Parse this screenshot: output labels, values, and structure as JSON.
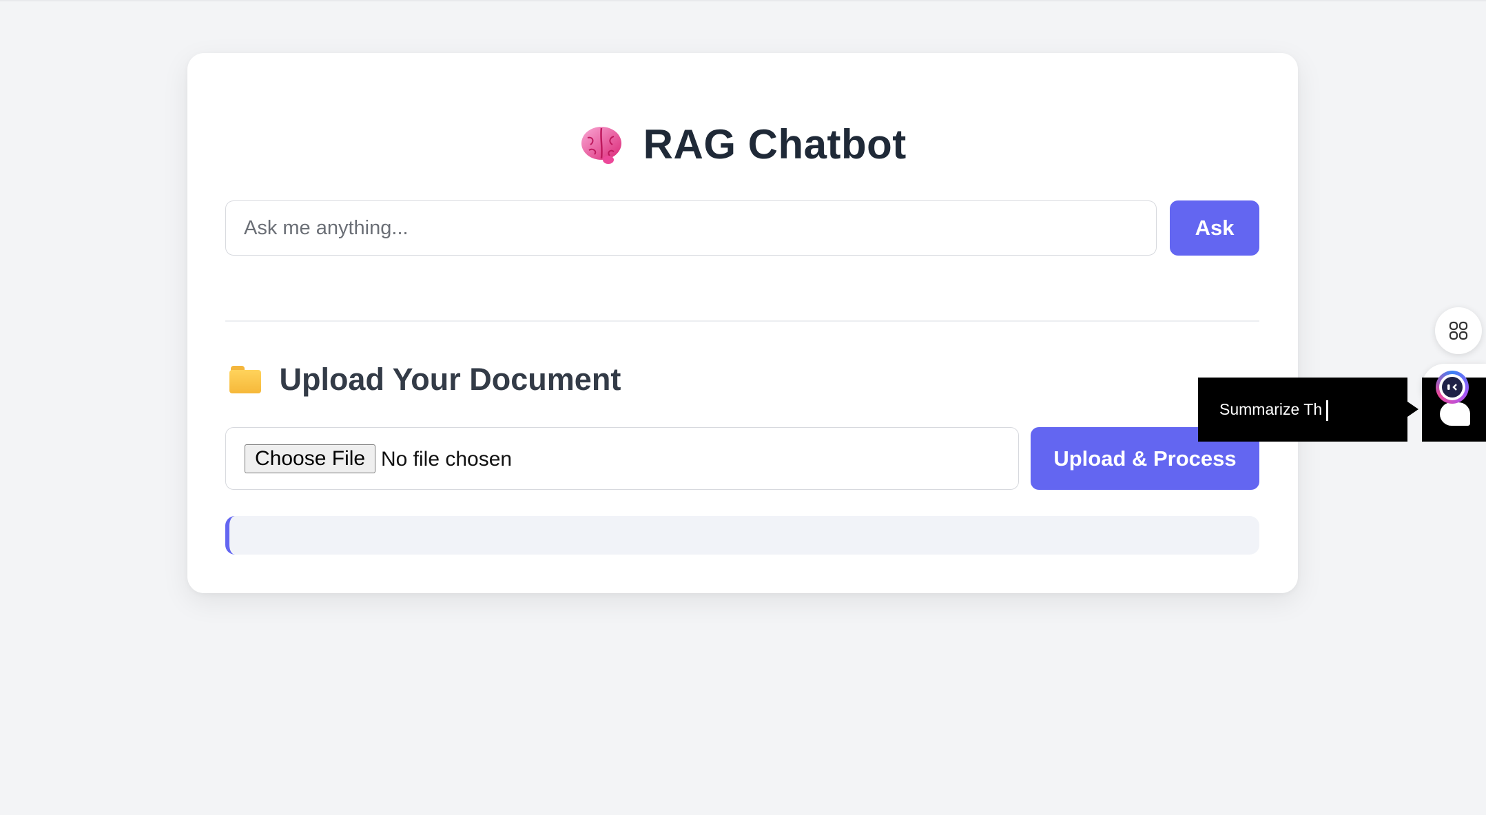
{
  "app": {
    "title": "RAG Chatbot",
    "title_icon": "brain-icon"
  },
  "chat": {
    "placeholder": "Ask me anything...",
    "value": "",
    "ask_label": "Ask"
  },
  "upload": {
    "heading": "Upload Your Document",
    "heading_icon": "folder-icon",
    "choose_label": "Choose File",
    "file_status": "No file chosen",
    "submit_label": "Upload & Process"
  },
  "status": {
    "text": ""
  },
  "widgets": {
    "apps_icon": "command-icon",
    "assistant_icon": "bot-avatar-icon",
    "tooltip_text": "Summarize Th"
  },
  "colors": {
    "accent": "#6366f1",
    "background": "#f3f4f6",
    "card": "#ffffff",
    "title": "#1f2937"
  }
}
